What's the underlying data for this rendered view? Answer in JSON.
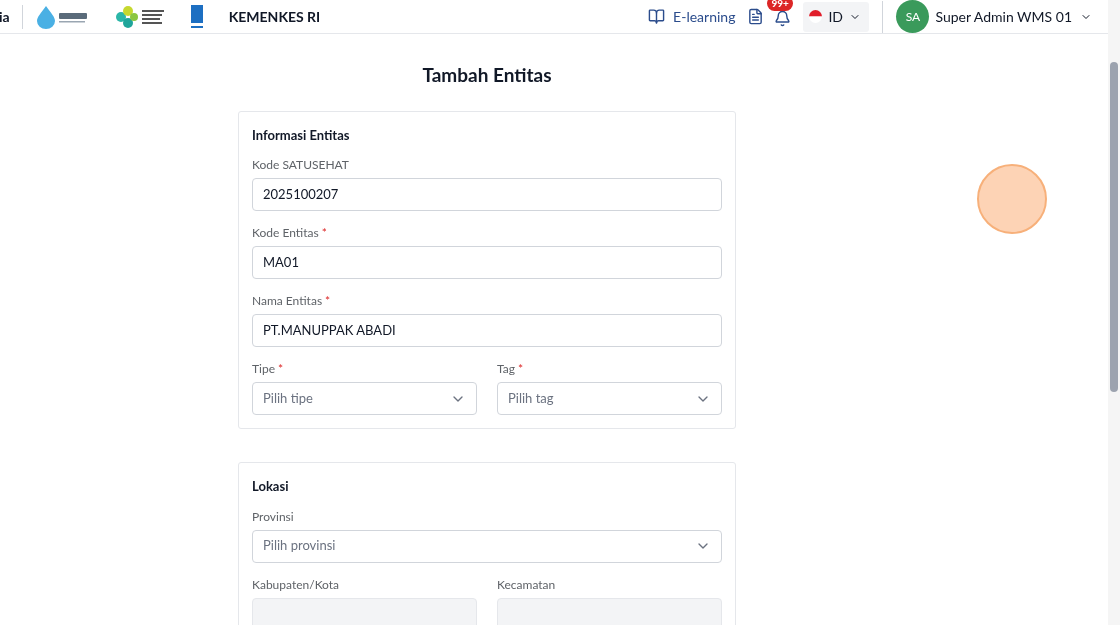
{
  "header": {
    "brand_fragment": "ia",
    "org_name": "KEMENKES RI",
    "elearning": "E-learning",
    "notification_count": "99+",
    "language": "ID",
    "user": {
      "initials": "SA",
      "name": "Super Admin WMS 01"
    }
  },
  "page_title": "Tambah Entitas",
  "sections": [
    {
      "title": "Informasi Entitas",
      "rows": [
        [
          {
            "kind": "text",
            "label": "Kode SATUSEHAT",
            "value": "2025100207",
            "disabled": false
          }
        ],
        [
          {
            "kind": "text",
            "label": "Kode Entitas",
            "required_mark": "*",
            "value": "MA01",
            "disabled": false
          }
        ],
        [
          {
            "kind": "text",
            "label": "Nama Entitas",
            "required_mark": "*",
            "value": "PT.MANUPPAK ABADI",
            "disabled": false
          }
        ],
        [
          {
            "kind": "select",
            "label": "Tipe",
            "required_mark": "*",
            "placeholder": "Pilih tipe",
            "disabled": false
          },
          {
            "kind": "select",
            "label": "Tag",
            "required_mark": "*",
            "placeholder": "Pilih tag",
            "disabled": false
          }
        ]
      ]
    },
    {
      "title": "Lokasi",
      "rows": [
        [
          {
            "kind": "select",
            "label": "Provinsi",
            "placeholder": "Pilih provinsi",
            "disabled": false
          }
        ],
        [
          {
            "kind": "select",
            "label": "Kabupaten/Kota",
            "disabled": true
          },
          {
            "kind": "select",
            "label": "Kecamatan",
            "disabled": true
          }
        ]
      ]
    }
  ]
}
